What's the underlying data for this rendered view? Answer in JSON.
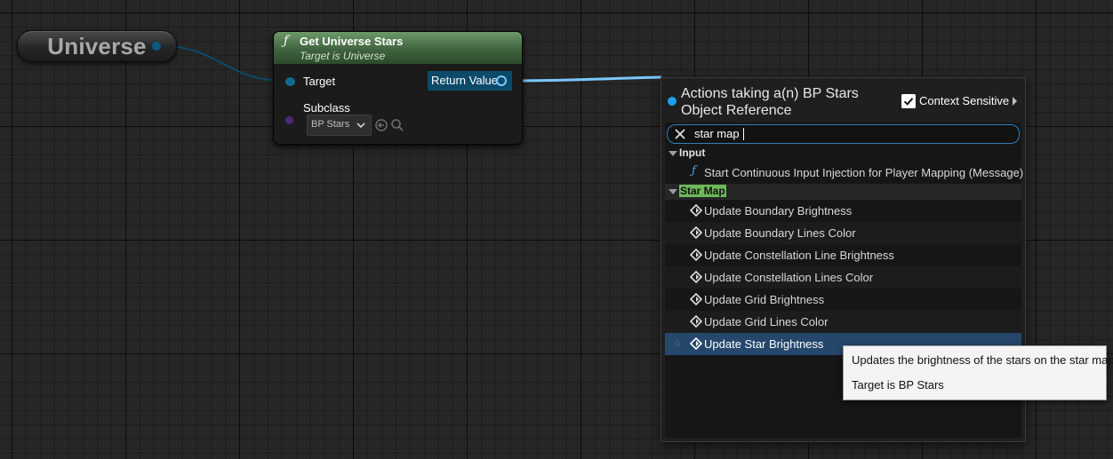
{
  "variable_node": {
    "title": "Universe"
  },
  "function_node": {
    "icon": "function-icon",
    "title": "Get Universe Stars",
    "subtitle": "Target is Universe",
    "target_label": "Target",
    "return_label": "Return Value",
    "subclass_label": "Subclass",
    "subclass_value": "BP Stars",
    "header_color": "#40633f"
  },
  "context_menu": {
    "title": "Actions taking a(n) BP Stars Object Reference",
    "context_sensitive_label": "Context Sensitive",
    "context_sensitive_checked": true,
    "search_value": "star map",
    "categories": [
      {
        "name": "Input",
        "items": [
          {
            "label": "Start Continuous Input Injection for Player Mapping (Message)",
            "icon": "function-icon"
          }
        ]
      },
      {
        "name": "Star Map",
        "highlight_color": "#6eb85a",
        "items": [
          {
            "label": "Update Boundary Brightness",
            "icon": "event-diamond-icon"
          },
          {
            "label": "Update Boundary Lines Color",
            "icon": "event-diamond-icon"
          },
          {
            "label": "Update Constellation Line Brightness",
            "icon": "event-diamond-icon"
          },
          {
            "label": "Update Constellation Lines Color",
            "icon": "event-diamond-icon"
          },
          {
            "label": "Update Grid Brightness",
            "icon": "event-diamond-icon"
          },
          {
            "label": "Update Grid Lines Color",
            "icon": "event-diamond-icon"
          },
          {
            "label": "Update Star Brightness",
            "icon": "event-diamond-icon",
            "selected": true
          }
        ]
      }
    ]
  },
  "tooltip": {
    "line1": "Updates the brightness of the stars on the star map",
    "line2": "Target is BP Stars"
  },
  "colors": {
    "wire_object": "#7cc7ff",
    "wire_dim": "#0c4a6a",
    "selection": "#25476b",
    "accent": "#1ba2ea"
  }
}
